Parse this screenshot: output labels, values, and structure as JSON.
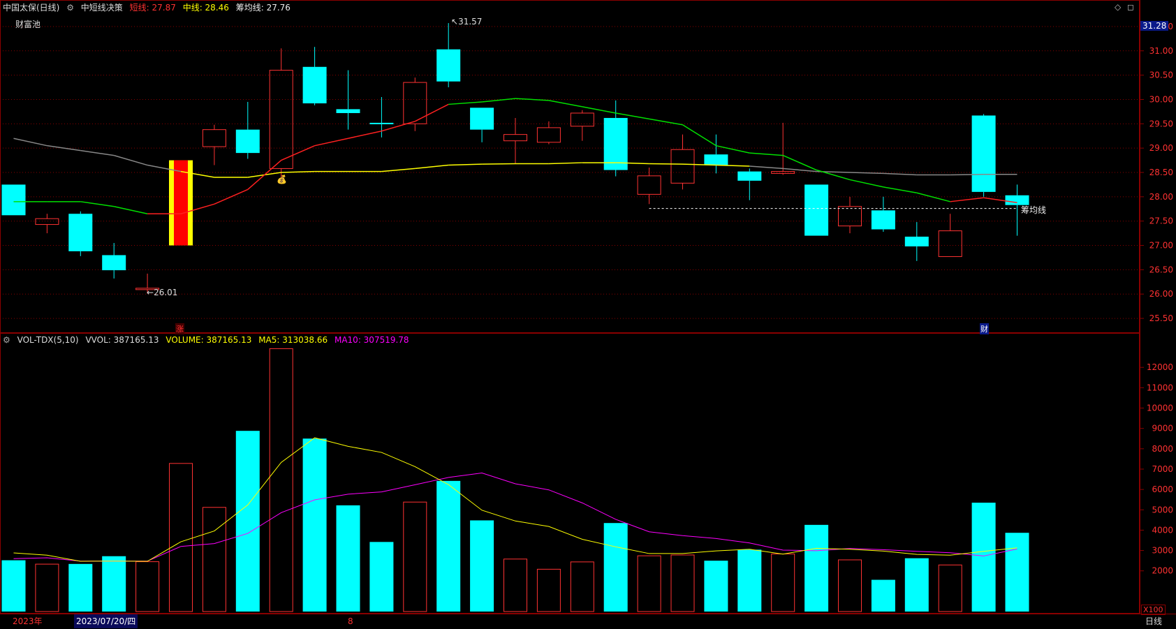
{
  "header": {
    "stock_name": "中国太保(日线)",
    "indicator_name": "中短线决策",
    "short_label": "短线: 27.87",
    "mid_label": "中线: 28.46",
    "chip_label": "筹均线: 27.76",
    "corner_label": "财富池"
  },
  "vol_header": {
    "indicator": "VOL-TDX(5,10)",
    "vvol": "VVOL: 387165.13",
    "volume": "VOLUME: 387165.13",
    "ma5": "MA5: 313038.66",
    "ma10": "MA10: 307519.78"
  },
  "colors": {
    "up": "#ff3232",
    "down": "#00ffff",
    "short_line": "#ff2020",
    "mid_line_up": "#00e000",
    "mid_line_flat": "#ffff00",
    "gray_line": "#888888",
    "ma5": "#ffff00",
    "ma10": "#ff00ff",
    "grid": "#8b0000",
    "axis_text": "#ff3232",
    "price_badge": "#0a1a8a"
  },
  "annotations": {
    "high_label": "31.57",
    "low_label": "26.01",
    "chip_line_label": "筹均线",
    "zhang_marker": "涨",
    "cai_marker": "财",
    "current_price": "31.28",
    "vol_unit": "X100"
  },
  "bottom": {
    "year": "2023年",
    "date_cursor": "2023/07/20/四",
    "month_mark": "8",
    "period": "日线"
  },
  "chart_data": {
    "type": "candlestick",
    "price_axis": {
      "ticks": [
        25.5,
        26.0,
        26.5,
        27.0,
        27.5,
        28.0,
        28.5,
        29.0,
        29.5,
        30.0,
        30.5,
        31.0,
        31.5
      ],
      "tick_labels": [
        "25.50",
        "26.00",
        "26.50",
        "27.00",
        "27.50",
        "28.00",
        "28.50",
        "29.00",
        "29.50",
        "30.00",
        "30.50",
        "31.00",
        "31.50"
      ],
      "ylim": [
        25.3,
        31.7
      ]
    },
    "candles": [
      {
        "o": 28.25,
        "c": 27.62,
        "h": 28.25,
        "l": 27.62
      },
      {
        "o": 27.43,
        "c": 27.55,
        "h": 27.65,
        "l": 27.25
      },
      {
        "o": 27.65,
        "c": 26.88,
        "h": 27.7,
        "l": 26.78
      },
      {
        "o": 26.8,
        "c": 26.49,
        "h": 27.05,
        "l": 26.32
      },
      {
        "o": 26.1,
        "c": 26.12,
        "h": 26.42,
        "l": 26.01
      },
      {
        "o": 27.0,
        "c": 28.75,
        "h": 28.75,
        "l": 27.0,
        "special": true
      },
      {
        "o": 29.03,
        "c": 29.38,
        "h": 29.48,
        "l": 28.65
      },
      {
        "o": 29.38,
        "c": 28.9,
        "h": 29.95,
        "l": 28.78
      },
      {
        "o": 28.58,
        "c": 30.6,
        "h": 31.05,
        "l": 28.4
      },
      {
        "o": 30.67,
        "c": 29.92,
        "h": 31.08,
        "l": 29.88
      },
      {
        "o": 29.8,
        "c": 29.72,
        "h": 30.6,
        "l": 29.38
      },
      {
        "o": 29.52,
        "c": 29.5,
        "h": 30.05,
        "l": 29.22
      },
      {
        "o": 29.5,
        "c": 30.35,
        "h": 30.45,
        "l": 29.35
      },
      {
        "o": 31.03,
        "c": 30.37,
        "h": 31.57,
        "l": 30.25
      },
      {
        "o": 29.83,
        "c": 29.38,
        "h": 29.83,
        "l": 29.12
      },
      {
        "o": 29.15,
        "c": 29.28,
        "h": 29.62,
        "l": 28.68
      },
      {
        "o": 29.12,
        "c": 29.42,
        "h": 29.55,
        "l": 29.08
      },
      {
        "o": 29.45,
        "c": 29.72,
        "h": 29.78,
        "l": 29.15
      },
      {
        "o": 29.62,
        "c": 28.55,
        "h": 29.98,
        "l": 28.42
      },
      {
        "o": 28.05,
        "c": 28.43,
        "h": 28.6,
        "l": 27.85
      },
      {
        "o": 28.28,
        "c": 28.97,
        "h": 29.28,
        "l": 28.15
      },
      {
        "o": 28.87,
        "c": 28.65,
        "h": 29.28,
        "l": 28.48
      },
      {
        "o": 28.52,
        "c": 28.33,
        "h": 28.58,
        "l": 27.93
      },
      {
        "o": 28.48,
        "c": 28.52,
        "h": 29.52,
        "l": 28.45
      },
      {
        "o": 28.25,
        "c": 27.2,
        "h": 28.25,
        "l": 27.2
      },
      {
        "o": 27.4,
        "c": 27.8,
        "h": 28.0,
        "l": 27.25
      },
      {
        "o": 27.72,
        "c": 27.33,
        "h": 28.0,
        "l": 27.28
      },
      {
        "o": 27.18,
        "c": 26.98,
        "h": 27.48,
        "l": 26.68
      },
      {
        "o": 26.77,
        "c": 27.3,
        "h": 27.65,
        "l": 26.77
      },
      {
        "o": 29.67,
        "c": 28.1,
        "h": 29.7,
        "l": 28.0
      },
      {
        "o": 28.03,
        "c": 27.83,
        "h": 28.25,
        "l": 27.2
      }
    ],
    "short_line": [
      27.9,
      27.9,
      27.9,
      27.8,
      27.65,
      27.65,
      27.85,
      28.15,
      28.75,
      29.05,
      29.2,
      29.35,
      29.55,
      29.9,
      29.95,
      30.02,
      29.98,
      29.85,
      29.72,
      29.6,
      29.48,
      29.05,
      28.9,
      28.85,
      28.55,
      28.35,
      28.2,
      28.08,
      27.9,
      27.98,
      27.88
    ],
    "mid_line": [
      29.2,
      29.05,
      28.95,
      28.85,
      28.65,
      28.52,
      28.4,
      28.4,
      28.5,
      28.52,
      28.52,
      28.52,
      28.58,
      28.65,
      28.67,
      28.68,
      28.68,
      28.7,
      28.7,
      28.68,
      28.67,
      28.65,
      28.63,
      28.58,
      28.52,
      28.5,
      28.48,
      28.45,
      28.45,
      28.46,
      28.46
    ],
    "mid_line_yellow_range": [
      5,
      22
    ],
    "chip_line_value": 27.76,
    "chip_line_range": [
      19,
      30
    ],
    "volume_axis": {
      "ticks": [
        2000,
        3000,
        4000,
        5000,
        6000,
        7000,
        8000,
        9000,
        10000,
        11000,
        12000
      ],
      "tick_labels": [
        "2000",
        "3000",
        "4000",
        "5000",
        "6000",
        "7000",
        "8000",
        "9000",
        "10000",
        "11000",
        "12000"
      ],
      "ylim": [
        0,
        12900
      ],
      "unit": "X100"
    },
    "volumes": [
      2520,
      2330,
      2340,
      2720,
      2450,
      7280,
      5120,
      8880,
      12920,
      8500,
      5220,
      3420,
      5380,
      6420,
      4480,
      2580,
      2080,
      2440,
      4350,
      2740,
      2780,
      2500,
      3040,
      2830,
      4260,
      2540,
      1560,
      2620,
      2290,
      5350,
      3870
    ],
    "ma5": [
      2880,
      2770,
      2470,
      2480,
      2470,
      3430,
      3960,
      5240,
      7330,
      8540,
      8120,
      7820,
      7120,
      6240,
      4980,
      4450,
      4180,
      3550,
      3180,
      2850,
      2850,
      2980,
      3060,
      2820,
      3110,
      3060,
      2970,
      2810,
      2770,
      2960,
      3130
    ],
    "ma10": [
      2600,
      2640,
      2480,
      2480,
      2480,
      3200,
      3340,
      3840,
      4860,
      5490,
      5770,
      5880,
      6230,
      6590,
      6810,
      6280,
      5980,
      5340,
      4530,
      3920,
      3730,
      3590,
      3370,
      3020,
      2990,
      3100,
      3040,
      2960,
      2890,
      2730,
      3075
    ]
  }
}
